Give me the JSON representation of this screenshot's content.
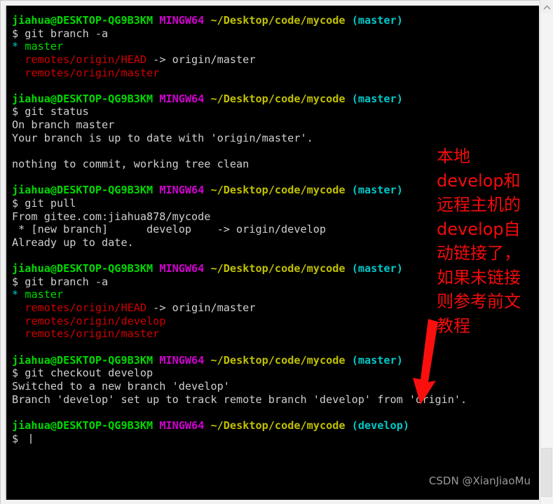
{
  "window": {
    "kind": "git-bash-terminal",
    "background": "#000000",
    "frame_color": "#f2f2f2"
  },
  "terminal": {
    "prompt_user": "jiahua@DESKTOP-QG9B3KM",
    "prompt_shell": "MINGW64",
    "prompt_path": "~/Desktop/code/mycode",
    "colors": {
      "user": "#00d900",
      "shell": "#d000d0",
      "path": "#c0c000",
      "branch": "#00c8c8",
      "text": "#cfcfcf",
      "red": "#d00000",
      "green": "#00d900"
    },
    "blocks": [
      {
        "branch": "(master)",
        "command": "$ git branch -a",
        "output": [
          [
            {
              "t": "*",
              "c": "cyan"
            },
            {
              "t": " ",
              "c": "white"
            },
            {
              "t": "master",
              "c": "green"
            }
          ],
          [
            {
              "t": "  ",
              "c": "white"
            },
            {
              "t": "remotes/origin/HEAD",
              "c": "red"
            },
            {
              "t": " -> origin/master",
              "c": "white"
            }
          ],
          [
            {
              "t": "  ",
              "c": "white"
            },
            {
              "t": "remotes/origin/master",
              "c": "red"
            }
          ],
          [
            {
              "t": "",
              "c": "white"
            }
          ]
        ]
      },
      {
        "branch": "(master)",
        "command": "$ git status",
        "output": [
          [
            {
              "t": "On branch master",
              "c": "white"
            }
          ],
          [
            {
              "t": "Your branch is up to date with 'origin/master'.",
              "c": "white"
            }
          ],
          [
            {
              "t": "",
              "c": "white"
            }
          ],
          [
            {
              "t": "nothing to commit, working tree clean",
              "c": "white"
            }
          ],
          [
            {
              "t": "",
              "c": "white"
            }
          ]
        ]
      },
      {
        "branch": "(master)",
        "command": "$ git pull",
        "output": [
          [
            {
              "t": "From gitee.com:jiahua878/mycode",
              "c": "white"
            }
          ],
          [
            {
              "t": " * [new branch]      develop    -> origin/develop",
              "c": "white"
            }
          ],
          [
            {
              "t": "Already up to date.",
              "c": "white"
            }
          ],
          [
            {
              "t": "",
              "c": "white"
            }
          ]
        ]
      },
      {
        "branch": "(master)",
        "command": "$ git branch -a",
        "output": [
          [
            {
              "t": "*",
              "c": "cyan"
            },
            {
              "t": " ",
              "c": "white"
            },
            {
              "t": "master",
              "c": "green"
            }
          ],
          [
            {
              "t": "  ",
              "c": "white"
            },
            {
              "t": "remotes/origin/HEAD",
              "c": "red"
            },
            {
              "t": " -> origin/master",
              "c": "white"
            }
          ],
          [
            {
              "t": "  ",
              "c": "white"
            },
            {
              "t": "remotes/origin/develop",
              "c": "red"
            }
          ],
          [
            {
              "t": "  ",
              "c": "white"
            },
            {
              "t": "remotes/origin/master",
              "c": "red"
            }
          ],
          [
            {
              "t": "",
              "c": "white"
            }
          ]
        ]
      },
      {
        "branch": "(master)",
        "command": "$ git checkout develop",
        "output": [
          [
            {
              "t": "Switched to a new branch 'develop'",
              "c": "white"
            }
          ],
          [
            {
              "t": "Branch 'develop' set up to track remote branch 'develop' from 'origin'.",
              "c": "white"
            }
          ],
          [
            {
              "t": "",
              "c": "white"
            }
          ]
        ]
      },
      {
        "branch": "(develop)",
        "command": "$ ",
        "cursor": true,
        "output": []
      }
    ]
  },
  "annotation": {
    "text": "本地develop和远程主机的develop自动链接了，如果未链接则参考前文教程",
    "color": "#f30b0b"
  },
  "arrow": {
    "color": "#fa0f0f",
    "label": "red-down-arrow"
  },
  "watermark": {
    "text": "CSDN @XianJiaoMu"
  },
  "scrollbar": {
    "up_arrow": "⌃",
    "position": "right"
  }
}
